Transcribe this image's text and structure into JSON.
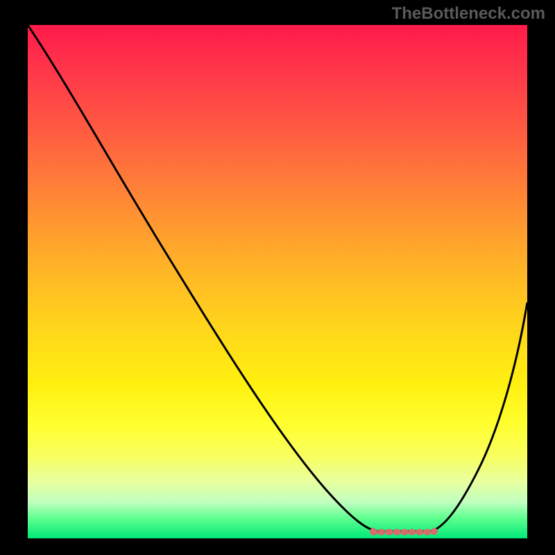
{
  "watermark": "TheBottleneck.com",
  "chart_data": {
    "type": "line",
    "title": "",
    "xlabel": "",
    "ylabel": "",
    "xlim": [
      0,
      100
    ],
    "ylim": [
      0,
      100
    ],
    "grid": false,
    "description": "Bottleneck curve plot; a steep descending black curve from top-left falling to a flat green minimum around x=68-82%, then rising toward the right. Background is a vertical gradient from red (high bottleneck) at top through orange/yellow to green (low bottleneck) at bottom.",
    "series": [
      {
        "name": "bottleneck-curve",
        "x": [
          0,
          10,
          20,
          30,
          40,
          50,
          60,
          65,
          70,
          75,
          80,
          85,
          90,
          95,
          100
        ],
        "values": [
          100,
          85,
          70,
          55,
          40,
          26,
          13,
          7,
          2,
          1,
          2,
          8,
          20,
          35,
          52
        ]
      }
    ],
    "optimal_range": {
      "x_start": 68,
      "x_end": 82,
      "marker_color": "#d86b6b"
    },
    "gradient_stops": [
      {
        "pct": 0,
        "color": "#ff1a4a"
      },
      {
        "pct": 50,
        "color": "#ffd31c"
      },
      {
        "pct": 80,
        "color": "#ffff30"
      },
      {
        "pct": 100,
        "color": "#00e878"
      }
    ]
  }
}
